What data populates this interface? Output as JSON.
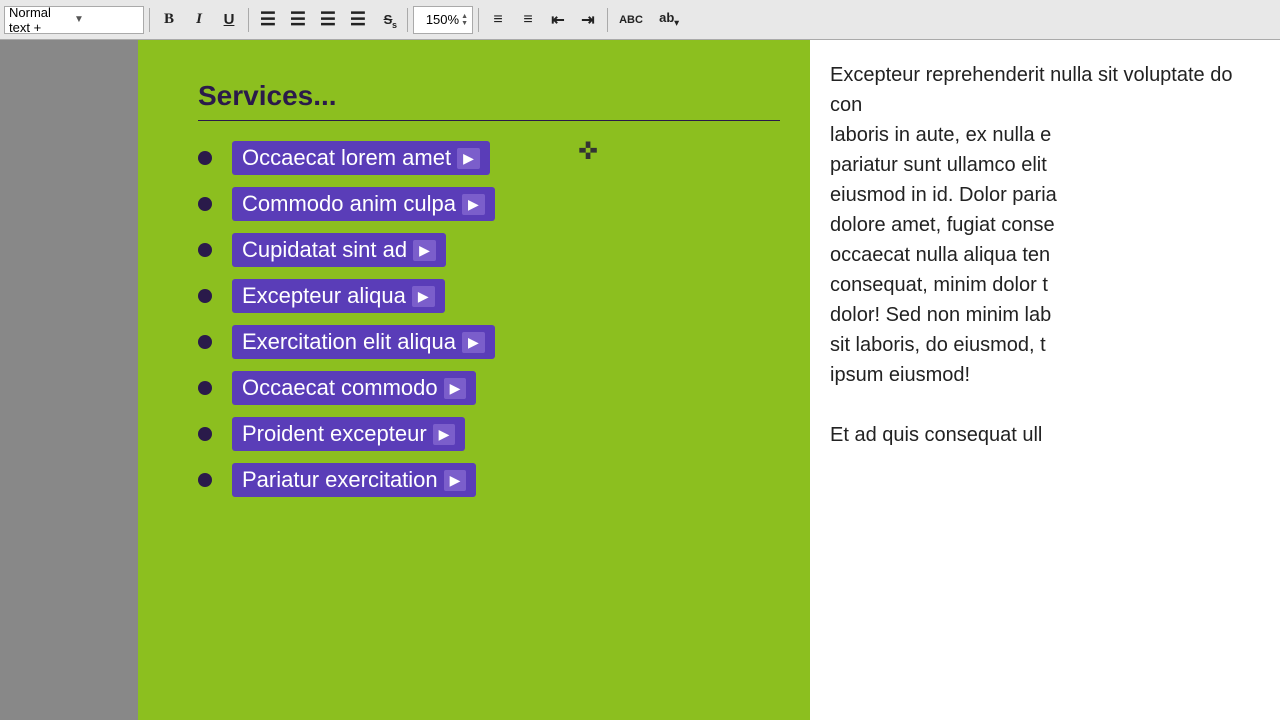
{
  "toolbar": {
    "style_label": "Normal text +",
    "bold_label": "B",
    "italic_label": "I",
    "underline_label": "U",
    "strikethrough_label": "S",
    "align_left": "≡",
    "align_center": "≡",
    "align_right": "≡",
    "align_justify": "≡",
    "zoom_value": "150%",
    "list_unordered": "≡",
    "list_ordered": "≡",
    "outdent": "⇤",
    "indent": "⇥",
    "spellcheck": "ABC",
    "format": "ab"
  },
  "green_panel": {
    "title": "Services...",
    "items": [
      {
        "label": "Occaecat lorem amet",
        "has_arrow": true
      },
      {
        "label": "Commodo anim culpa",
        "has_arrow": true
      },
      {
        "label": "Cupidatat sint ad",
        "has_arrow": true
      },
      {
        "label": "Excepteur aliqua",
        "has_arrow": true
      },
      {
        "label": "Exercitation elit aliqua",
        "has_arrow": true
      },
      {
        "label": "Occaecat commodo",
        "has_arrow": true
      },
      {
        "label": "Proident excepteur",
        "has_arrow": true
      },
      {
        "label": "Pariatur exercitation",
        "has_arrow": true
      }
    ]
  },
  "right_panel": {
    "text": "Excepteur reprehenderit nulla sit voluptate do con laboris in aute, ex nulla e pariatur sunt ullamco elit eiusmod in id. Dolor paria dolore amet, fugiat conse occaecat nulla aliqua ten consequat, minim dolor t dolor! Sed non minim lab sit laboris, do eiusmod, t ipsum eiusmod!\n\nEt ad quis consequat ull"
  },
  "colors": {
    "purple_bg": "#5a3db8",
    "green_bg": "#8cbf1f",
    "dark_text": "#2a1a4a",
    "white": "#ffffff"
  }
}
